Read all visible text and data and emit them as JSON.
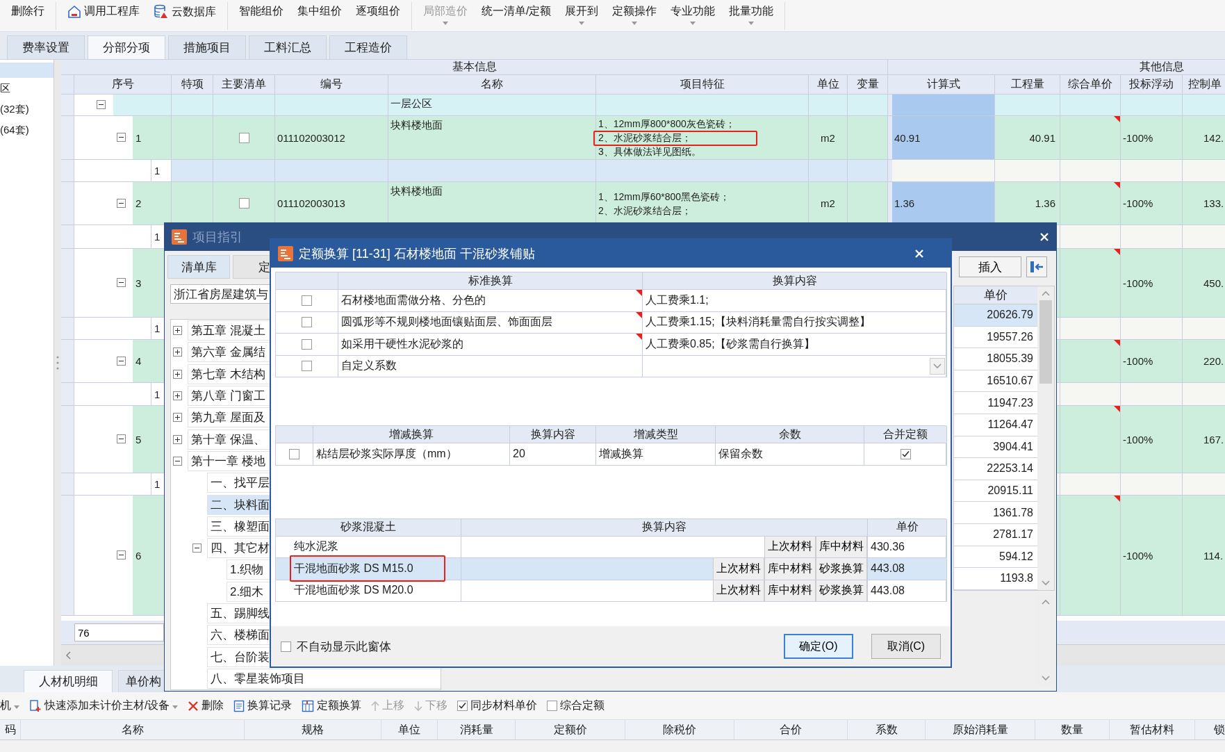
{
  "toolbar": {
    "groups": [
      [
        {
          "label": "删除行",
          "disabled": false,
          "dropdown": false
        }
      ],
      [
        {
          "label": "调用工程库",
          "disabled": false,
          "dropdown": false
        },
        {
          "label": "云数据库",
          "disabled": false,
          "dropdown": false
        }
      ],
      [
        {
          "label": "智能组价",
          "disabled": false,
          "dropdown": false
        },
        {
          "label": "集中组价",
          "disabled": false,
          "dropdown": false
        },
        {
          "label": "逐项组价",
          "disabled": false,
          "dropdown": false
        }
      ],
      [
        {
          "label": "局部造价",
          "disabled": true,
          "dropdown": true
        },
        {
          "label": "统一清单/定额",
          "disabled": false,
          "dropdown": false
        },
        {
          "label": "展开到",
          "disabled": false,
          "dropdown": true
        },
        {
          "label": "定额操作",
          "disabled": false,
          "dropdown": true
        },
        {
          "label": "专业功能",
          "disabled": false,
          "dropdown": true
        },
        {
          "label": "批量功能",
          "disabled": false,
          "dropdown": true
        }
      ]
    ]
  },
  "tabs": [
    {
      "label": "费率设置",
      "selected": false
    },
    {
      "label": "分部分项",
      "selected": true
    },
    {
      "label": "措施项目",
      "selected": false
    },
    {
      "label": "工料汇总",
      "selected": false
    },
    {
      "label": "工程造价",
      "selected": false
    }
  ],
  "left_panel": {
    "items": [
      "区",
      "(32套)",
      "(64套)"
    ]
  },
  "grid": {
    "header_groups": [
      "基本信息",
      "其他信息"
    ],
    "columns": [
      "序号",
      "特项",
      "主要清单",
      "编号",
      "名称",
      "项目特征",
      "单位",
      "变量",
      "计算式",
      "工程量",
      "综合单价",
      "投标浮动",
      "控制单"
    ],
    "rows": [
      {
        "kind": "group",
        "name": "一层公区",
        "expanded": true
      },
      {
        "kind": "item",
        "seq": "1",
        "expanded": true,
        "main_list": false,
        "code": "011102003012",
        "name": "块料楼地面",
        "features": [
          "1、12mm厚800*800灰色瓷砖；",
          "2、水泥砂浆结合层；",
          "3、具体做法详见图纸。"
        ],
        "highlighted": true,
        "unit": "m2",
        "formula": "40.91",
        "quantity": "40.91",
        "flagged": true,
        "float": "-100%",
        "control": "142."
      },
      {
        "kind": "sub",
        "seq": "1"
      },
      {
        "kind": "item",
        "seq": "2",
        "expanded": true,
        "main_list": false,
        "code": "011102003013",
        "name": "块料楼地面",
        "features": [
          "1、12mm厚60*800黑色瓷砖；",
          "2、水泥砂浆结合层；"
        ],
        "highlighted": false,
        "unit": "m2",
        "formula": "1.36",
        "quantity": "1.36",
        "flagged": true,
        "float": "-100%",
        "control": "133."
      },
      {
        "kind": "sub",
        "seq": "1"
      },
      {
        "kind": "item",
        "seq": "3",
        "expanded": true,
        "flagged": true,
        "float": "-100%",
        "control": "450."
      },
      {
        "kind": "sub",
        "seq": "1"
      },
      {
        "kind": "item",
        "seq": "4",
        "expanded": true,
        "flagged": true,
        "float": "-100%",
        "control": "220."
      },
      {
        "kind": "sub",
        "seq": "1"
      },
      {
        "kind": "item",
        "seq": "5",
        "expanded": true,
        "flagged": true,
        "float": "-100%",
        "control": "167."
      },
      {
        "kind": "sub",
        "seq": "1"
      },
      {
        "kind": "item",
        "seq": "6",
        "expanded": true,
        "flagged": true,
        "float": "-100%",
        "control": "114."
      }
    ],
    "footer_value": "76"
  },
  "guide": {
    "title": "项目指引",
    "tabs": [
      {
        "label": "清单库",
        "selected": true
      },
      {
        "label": "定",
        "selected": false
      }
    ],
    "library": "浙江省房屋建筑与",
    "tree": [
      {
        "label": "第五章 混凝土",
        "expanded": false,
        "selected": false
      },
      {
        "label": "第六章 金属结",
        "expanded": false,
        "selected": false
      },
      {
        "label": "第七章 木结构",
        "expanded": false,
        "selected": false
      },
      {
        "label": "第八章 门窗工",
        "expanded": false,
        "selected": false
      },
      {
        "label": "第九章 屋面及",
        "expanded": false,
        "selected": false
      },
      {
        "label": "第十章 保温、",
        "expanded": false,
        "selected": false
      },
      {
        "label": "第十一章 楼地",
        "expanded": true,
        "selected": false,
        "children": [
          {
            "label": "一、找平层",
            "selected": false
          },
          {
            "label": "二、块料面",
            "selected": true
          },
          {
            "label": "三、橡塑面",
            "selected": false
          },
          {
            "label": "四、其它材",
            "expanded": true,
            "selected": false,
            "children": [
              {
                "label": "1.织物",
                "selected": false
              },
              {
                "label": "2.细木",
                "selected": false
              }
            ]
          },
          {
            "label": "五、踢脚线",
            "selected": false
          },
          {
            "label": "六、楼梯面",
            "selected": false
          },
          {
            "label": "七、台阶装",
            "selected": false
          },
          {
            "label": "八、零星装饰项目",
            "selected": false
          }
        ]
      }
    ],
    "insert_button": "插入",
    "price_header": "单价",
    "prices": [
      {
        "value": "20626.79",
        "selected": true
      },
      {
        "value": "19557.26",
        "selected": false
      },
      {
        "value": "18055.39",
        "selected": false
      },
      {
        "value": "16510.67",
        "selected": false
      },
      {
        "value": "11947.23",
        "selected": false
      },
      {
        "value": "11264.47",
        "selected": false
      },
      {
        "value": "3904.41",
        "selected": false
      },
      {
        "value": "22253.14",
        "selected": false
      },
      {
        "value": "20915.11",
        "selected": false
      },
      {
        "value": "1361.78",
        "selected": false
      },
      {
        "value": "2781.17",
        "selected": false
      },
      {
        "value": "594.12",
        "selected": false
      },
      {
        "value": "1193.8",
        "selected": false
      }
    ]
  },
  "dialog": {
    "title": "定额换算 [11-31] 石材楼地面 干混砂浆铺贴",
    "standard": {
      "columns": [
        "标准换算",
        "换算内容"
      ],
      "rows": [
        {
          "kind": "text",
          "checked": false,
          "name": "石材楼地面需做分格、分色的",
          "flagged": true,
          "content": "人工费乘1.1;"
        },
        {
          "kind": "text",
          "checked": false,
          "name": "圆弧形等不规则楼地面镶贴面层、饰面面层",
          "flagged": true,
          "content": "人工费乘1.15;【块料消耗量需自行按实调整】"
        },
        {
          "kind": "text",
          "checked": false,
          "name": "如采用干硬性水泥砂浆的",
          "flagged": true,
          "content": "人工费乘0.85;【砂浆需自行换算】"
        },
        {
          "kind": "dropdown",
          "checked": false,
          "name": "自定义系数",
          "flagged": false
        }
      ]
    },
    "adjust": {
      "columns": [
        "增减换算",
        "换算内容",
        "增减类型",
        "余数",
        "合并定额"
      ],
      "rows": [
        {
          "checked": false,
          "name": "粘结层砂浆实际厚度（mm）",
          "content": "20",
          "type": "增减换算",
          "remainder": "保留余数",
          "merge": true
        }
      ]
    },
    "mortar": {
      "columns": [
        "砂浆混凝土",
        "换算内容",
        "单价"
      ],
      "rows": [
        {
          "name": "纯水泥浆",
          "buttons": [
            "上次材料",
            "库中材料"
          ],
          "price": "430.36",
          "selected": false,
          "highlighted": false
        },
        {
          "name": "干混地面砂浆 DS M15.0",
          "buttons": [
            "上次材料",
            "库中材料",
            "砂浆换算"
          ],
          "price": "443.08",
          "selected": true,
          "highlighted": true
        },
        {
          "name": "干混地面砂浆 DS M20.0",
          "buttons": [
            "上次材料",
            "库中材料",
            "砂浆换算"
          ],
          "price": "443.08",
          "selected": false,
          "highlighted": false
        }
      ]
    },
    "footer": {
      "checkbox": {
        "label": "不自动显示此窗体",
        "checked": false
      },
      "buttons": [
        {
          "label": "确定(O)",
          "default": true
        },
        {
          "label": "取消(C)",
          "default": false
        }
      ]
    }
  },
  "bottom": {
    "tabs": [
      {
        "label": "人材机明细",
        "selected": true
      },
      {
        "label": "单价构",
        "selected": false
      }
    ],
    "tools": [
      {
        "kind": "button",
        "label": "机",
        "dropdown": true,
        "disabled": false
      },
      {
        "kind": "button",
        "label": "快速添加未计价主材/设备",
        "dropdown": true,
        "disabled": false
      },
      {
        "kind": "button",
        "label": "删除",
        "dropdown": false,
        "disabled": false
      },
      {
        "kind": "button",
        "label": "换算记录",
        "dropdown": false,
        "disabled": false
      },
      {
        "kind": "button",
        "label": "定额换算",
        "dropdown": false,
        "disabled": false
      },
      {
        "kind": "button",
        "label": "上移",
        "dropdown": false,
        "disabled": true
      },
      {
        "kind": "button",
        "label": "下移",
        "dropdown": false,
        "disabled": true
      },
      {
        "kind": "checkbox",
        "label": "同步材料单价",
        "checked": true
      },
      {
        "kind": "checkbox",
        "label": "综合定额",
        "checked": false
      }
    ],
    "columns": [
      "码",
      "名称",
      "规格",
      "单位",
      "消耗量",
      "定额价",
      "除税价",
      "合价",
      "系数",
      "原始消耗量",
      "数量",
      "暂估材料",
      "锁"
    ]
  }
}
